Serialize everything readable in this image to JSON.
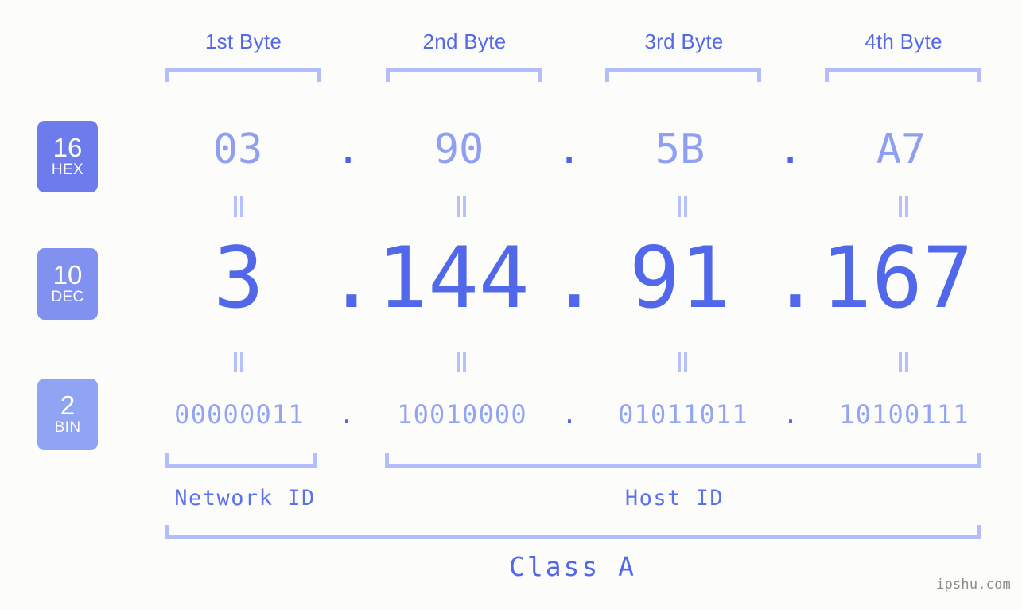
{
  "meta": {
    "background_color": "#fcfdfa",
    "accent_color": "#5168ea",
    "light_accent_color": "#b4bdfb",
    "watermark": "ipshu.com"
  },
  "byte_headers": [
    {
      "label": "1st Byte"
    },
    {
      "label": "2nd Byte"
    },
    {
      "label": "3rd Byte"
    },
    {
      "label": "4th Byte"
    }
  ],
  "radix_badges": [
    {
      "number": "16",
      "system": "HEX",
      "color": "#6c7cec"
    },
    {
      "number": "10",
      "system": "DEC",
      "color": "#8191f0"
    },
    {
      "number": "2",
      "system": "BIN",
      "color": "#8fa4f3"
    }
  ],
  "rows": {
    "hex": {
      "values": [
        "03",
        "90",
        "5B",
        "A7"
      ],
      "separator": "."
    },
    "dec": {
      "values": [
        "3",
        "144",
        "91",
        "167"
      ],
      "separator": "."
    },
    "bin": {
      "values": [
        "00000011",
        "10010000",
        "01011011",
        "10100111"
      ],
      "separator": "."
    }
  },
  "equality_marks": {
    "symbol": "=",
    "count_per_row": 4
  },
  "sections": {
    "network_id": "Network ID",
    "host_id": "Host ID",
    "class": "Class A"
  }
}
